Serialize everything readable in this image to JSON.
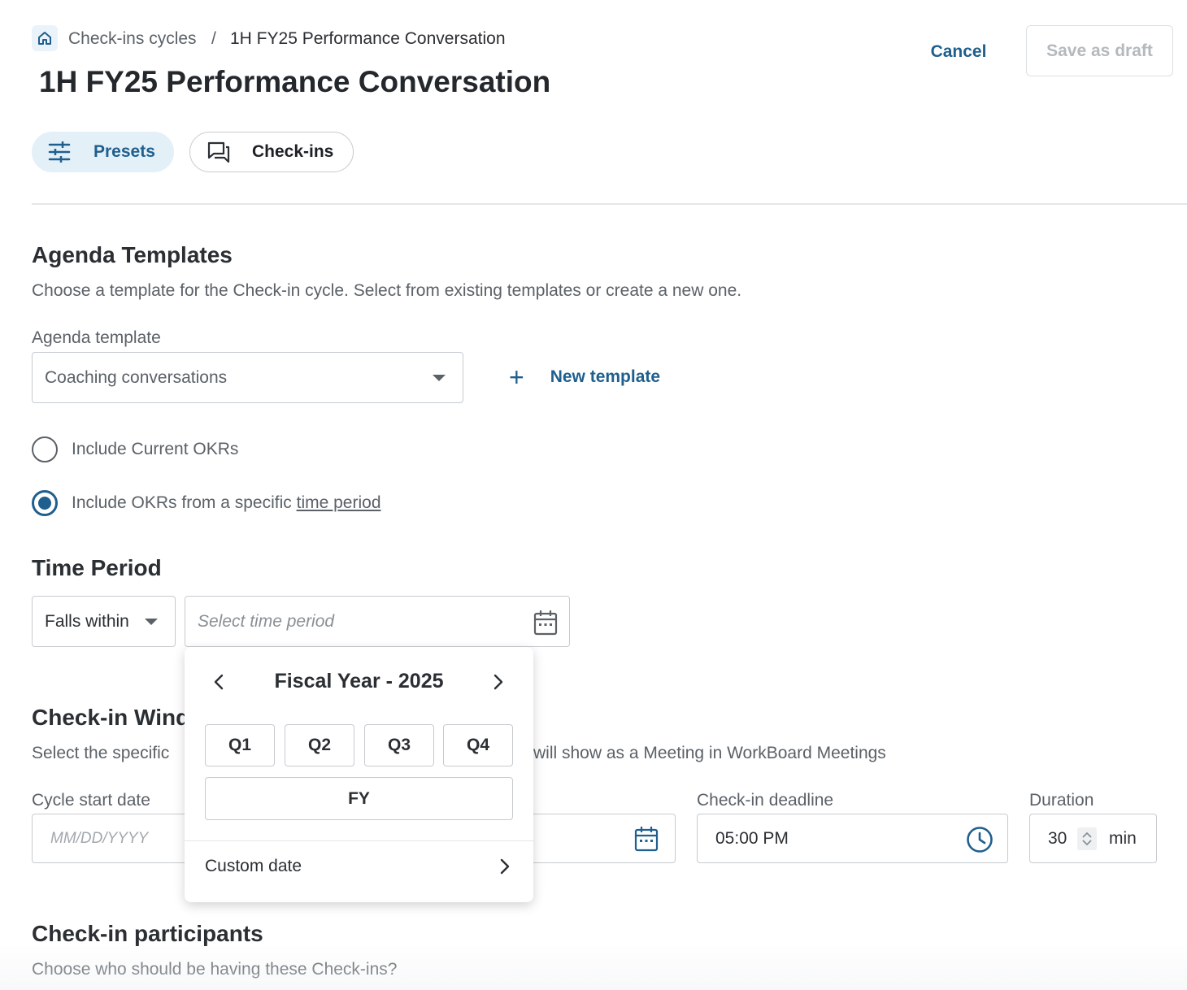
{
  "breadcrumb": {
    "items": [
      "Check-ins cycles",
      "1H FY25 Performance Conversation"
    ],
    "separator": "/"
  },
  "header": {
    "title": "1H FY25 Performance Conversation",
    "cancel_label": "Cancel",
    "save_draft_label": "Save as draft"
  },
  "tabs": [
    {
      "label": "Presets",
      "active": true,
      "icon": "sliders-icon"
    },
    {
      "label": "Check-ins",
      "active": false,
      "icon": "chat-bubbles-icon"
    }
  ],
  "agenda": {
    "heading": "Agenda Templates",
    "description": "Choose a template for the Check-in cycle. Select from existing templates or create a new one.",
    "template_label": "Agenda template",
    "template_value": "Coaching conversations",
    "new_template_label": "New template",
    "radio_current": "Include Current OKRs",
    "radio_specific_prefix": "Include OKRs from a specific ",
    "radio_specific_link": "time period",
    "selected_radio": "specific"
  },
  "time_period": {
    "heading": "Time Period",
    "condition_value": "Falls within",
    "placeholder": "Select time period"
  },
  "picker": {
    "title": "Fiscal Year - 2025",
    "quarters": [
      "Q1",
      "Q2",
      "Q3",
      "Q4"
    ],
    "fy_label": "FY",
    "custom_label": "Custom date"
  },
  "window": {
    "heading_visible": "Check-in Wind",
    "desc_left": "Select the specific",
    "desc_right": " will show as a Meeting in WorkBoard Meetings",
    "start_label": "Cycle start date",
    "start_placeholder": "MM/DD/YYYY",
    "deadline_label": "Check-in deadline",
    "deadline_value": "05:00 PM",
    "duration_label": "Duration",
    "duration_value": "30",
    "duration_unit": "min"
  },
  "participants": {
    "heading": "Check-in participants",
    "description": "Choose who should be having these Check-ins?"
  },
  "colors": {
    "accent": "#1f5f8e",
    "text": "#2b2f33",
    "muted": "#5b6167",
    "border": "#c7cbcf"
  }
}
